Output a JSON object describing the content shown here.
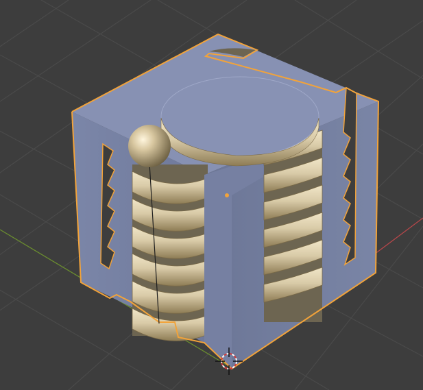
{
  "app": "3D viewport",
  "viewport": {
    "background_color": "#3d3d3d",
    "grid_color": "#4a4a4a",
    "x_axis_color": "#c24b4b",
    "y_axis_color": "#6b8e2f"
  },
  "scene": {
    "selected_object": {
      "name_icon": "cube-with-thread-cutout",
      "outline_color": "#f2a33a",
      "body_color": "#7f8aab",
      "top_color": "#8892b4",
      "thread_color": "#d9cba8"
    },
    "origin_point_color": "#f2a33a",
    "cursor_icon": "3d-cursor-icon"
  }
}
